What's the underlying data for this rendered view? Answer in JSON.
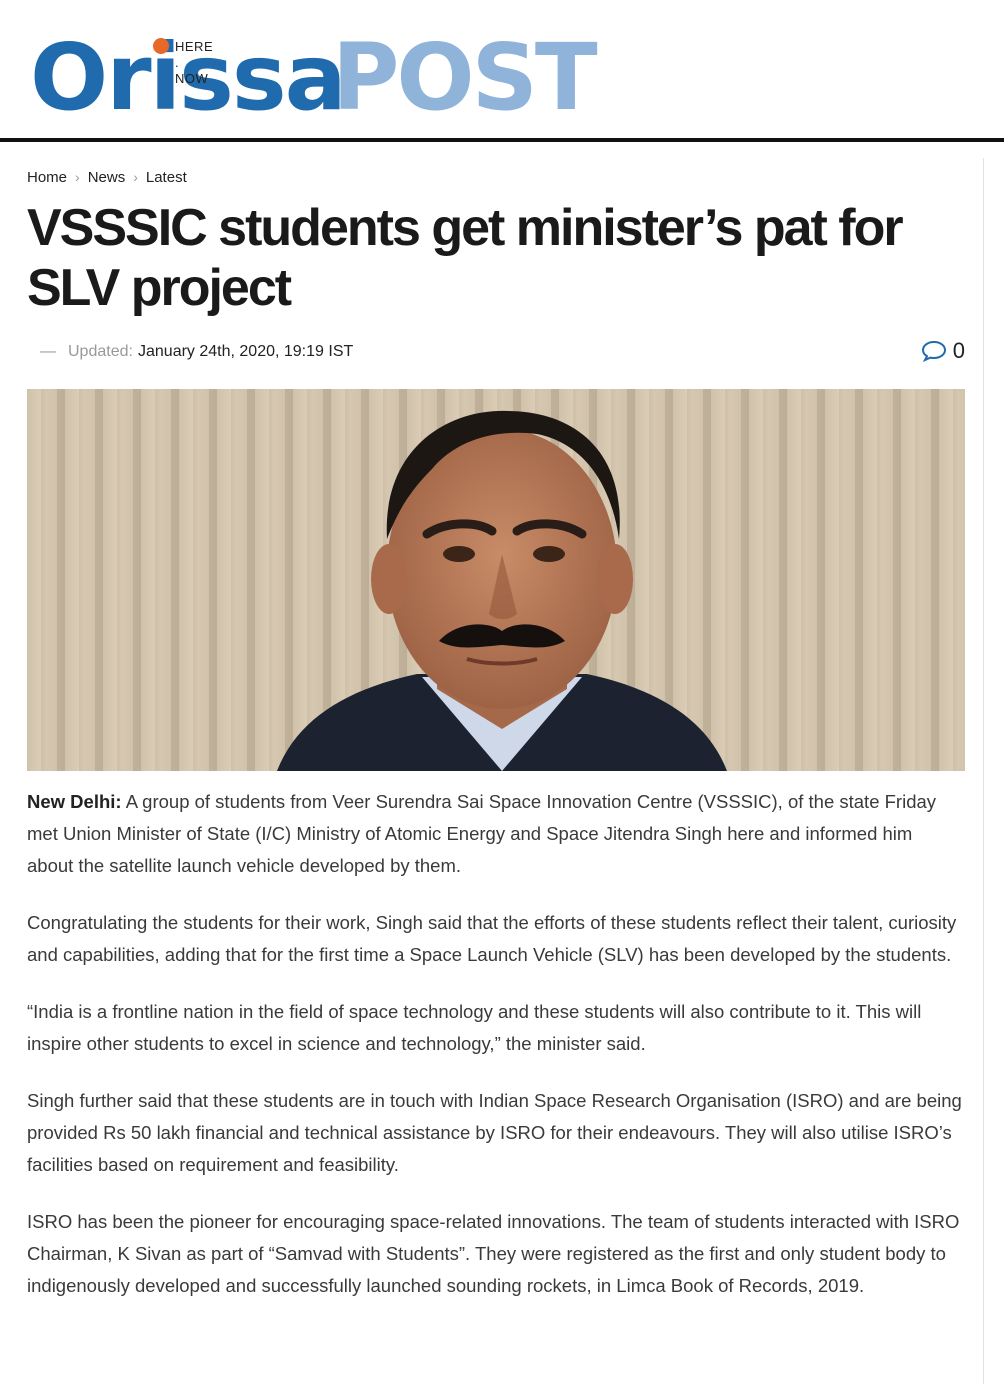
{
  "site": {
    "logo_part1": "Orissa",
    "logo_part2": "POST",
    "tagline": "HERE . NOW",
    "colors": {
      "primary_blue": "#1f6bad",
      "light_blue": "#8fb3d9",
      "dot_orange": "#e8682a"
    }
  },
  "breadcrumb": {
    "items": [
      "Home",
      "News",
      "Latest"
    ],
    "separator_icon": "chevron-right-icon"
  },
  "article": {
    "title": "VSSSIC students get minister’s pat for SLV project",
    "meta": {
      "dash": "—",
      "updated_label": "Updated:",
      "date": "January 24th, 2020, 19:19 IST",
      "comment_icon": "comment-bubble-icon",
      "comment_count": "0"
    },
    "image_subject": "portrait",
    "dateline": "New Delhi:",
    "paragraphs": [
      "A group of students from Veer Surendra Sai Space Innovation Centre (VSSSIC), of the state Friday met Union Minister of State (I/C) Ministry of Atomic Energy and Space Jitendra Singh here and informed him about the satellite launch vehicle developed by them.",
      "Congratulating the students for their work, Singh said that the efforts of these students reflect their talent, curiosity and capabilities, adding that for the first time a Space Launch Vehicle (SLV) has been developed by the students.",
      "“India is a frontline nation in the field of space technology and these students will also contribute to it. This will inspire other students to excel in science and technology,” the minister said.",
      "Singh further said that these students are in touch with Indian Space Research Organisation (ISRO) and are being provided Rs 50 lakh financial and technical assistance by ISRO for their endeavours. They will also utilise ISRO’s facilities based on requirement and feasibility.",
      "ISRO has been the pioneer for encouraging space-related innovations. The team of students interacted with ISRO Chairman, K Sivan as part of “Samvad with Students”. They were registered as the first and only student body to indigenously developed and successfully launched sounding rockets, in Limca Book of Records, 2019."
    ]
  }
}
